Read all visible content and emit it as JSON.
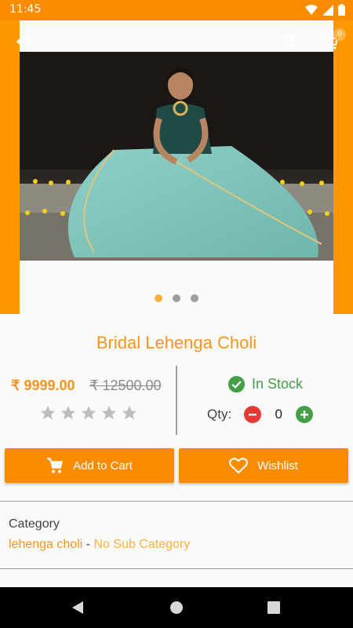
{
  "status_bar": {
    "time": "11:45"
  },
  "toolbar": {
    "cart_count": "0"
  },
  "gallery": {
    "page_count": 3,
    "active_page": 0
  },
  "product": {
    "title": "Bridal Lehenga Choli",
    "price": "₹ 9999.00",
    "original_price": "₹ 12500.00",
    "rating": 0,
    "max_rating": 5,
    "stock_status": "In Stock",
    "qty_label": "Qty:",
    "qty_value": "0"
  },
  "actions": {
    "add_to_cart_label": "Add to Cart",
    "wishlist_label": "Wishlist"
  },
  "category": {
    "heading": "Category",
    "main": "lehenga choli",
    "separator": " - ",
    "sub": "No Sub Category"
  },
  "colors": {
    "accent": "#ff9800",
    "title": "#f7941d",
    "in_stock": "#43a047",
    "minus": "#e53935",
    "plus": "#43a047"
  }
}
